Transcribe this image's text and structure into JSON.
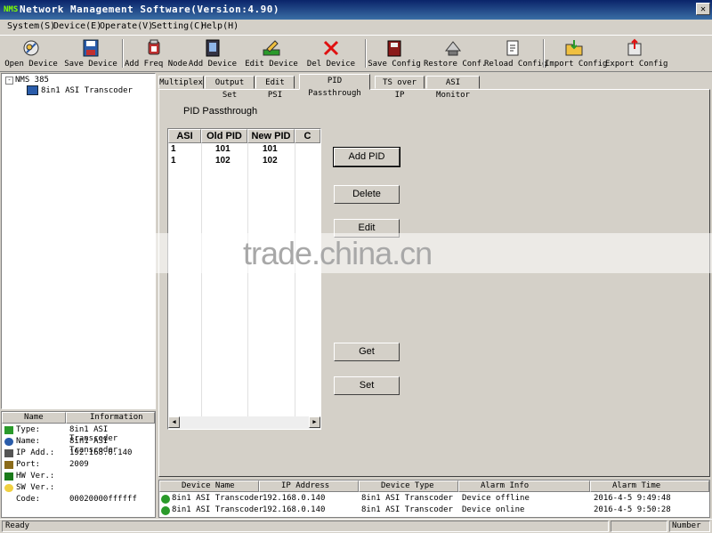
{
  "window": {
    "title": "Network Management Software(Version:4.90)",
    "app_icon_text": "NMS"
  },
  "menu": [
    "System(S)",
    "Device(E)",
    "Operate(V)",
    "Setting(C)",
    "Help(H)"
  ],
  "toolbar": [
    {
      "label": "Open Device",
      "icon": "open-device-icon"
    },
    {
      "label": "Save Device",
      "icon": "save-device-icon"
    },
    {
      "label": "Add Freq Node",
      "icon": "add-freq-node-icon"
    },
    {
      "label": "Add Device",
      "icon": "add-device-icon"
    },
    {
      "label": "Edit Device",
      "icon": "edit-device-icon"
    },
    {
      "label": "Del Device",
      "icon": "delete-icon"
    },
    {
      "label": "Save Config",
      "icon": "save-config-icon"
    },
    {
      "label": "Restore Conf.",
      "icon": "restore-config-icon"
    },
    {
      "label": "Reload Config",
      "icon": "reload-config-icon"
    },
    {
      "label": "Import Config",
      "icon": "import-config-icon"
    },
    {
      "label": "Export Config",
      "icon": "export-config-icon"
    }
  ],
  "tree": {
    "root": "NMS 385",
    "child": "8in1 ASI Transcoder"
  },
  "info": {
    "headers": {
      "name": "Name",
      "information": "Information"
    },
    "rows": [
      {
        "key": "Type:",
        "value": "8in1 ASI Transcoder"
      },
      {
        "key": "Name:",
        "value": "8in1 ASI Transcoder"
      },
      {
        "key": "IP Add.:",
        "value": "192.168.0.140"
      },
      {
        "key": "Port:",
        "value": "2009"
      },
      {
        "key": "HW Ver.:",
        "value": ""
      },
      {
        "key": "SW Ver.:",
        "value": ""
      },
      {
        "key": "Code:",
        "value": "00020000ffffff"
      }
    ]
  },
  "tabs": [
    "Multiplex",
    "Output Set",
    "Edit PSI",
    "PID Passthrough",
    "TS over IP",
    "ASI Monitor"
  ],
  "active_tab": "PID Passthrough",
  "pid": {
    "title": "PID Passthrough",
    "columns": [
      "ASI",
      "Old PID",
      "New PID",
      "C"
    ],
    "rows": [
      {
        "asi": "1",
        "old": "101",
        "new": "101"
      },
      {
        "asi": "1",
        "old": "102",
        "new": "102"
      }
    ],
    "buttons": {
      "add": "Add PID",
      "delete": "Delete",
      "edit": "Edit",
      "get": "Get",
      "set": "Set"
    }
  },
  "alarm": {
    "headers": [
      "Device Name",
      "IP Address",
      "Device Type",
      "Alarm Info",
      "Alarm Time"
    ],
    "rows": [
      {
        "name": "8in1 ASI Transcoder",
        "ip": "192.168.0.140",
        "type": "8in1 ASI Transcoder",
        "info": "Device offline",
        "time": "2016-4-5 9:49:48"
      },
      {
        "name": "8in1 ASI Transcoder",
        "ip": "192.168.0.140",
        "type": "8in1 ASI Transcoder",
        "info": "Device online",
        "time": "2016-4-5 9:50:28"
      }
    ]
  },
  "status": {
    "text": "Ready",
    "number": "Number"
  },
  "watermark": "trade.china.cn"
}
